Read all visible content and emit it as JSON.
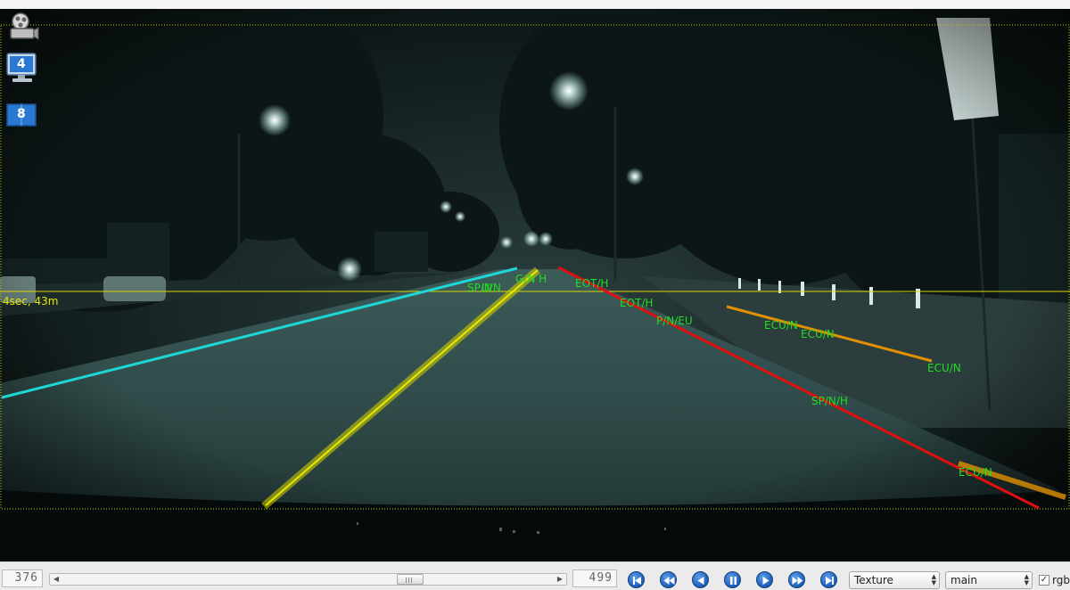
{
  "overlay": {
    "distance_label": "4sec, 43m",
    "lane_labels": [
      "EOT/H",
      "EOT/H",
      "P/N/EU",
      "ECU/N",
      "ECU/N",
      "ECU/N",
      "SP/N/H",
      "ECU/N"
    ],
    "near_vanishing_labels": [
      "SP/N",
      "U/N",
      "G/N H"
    ]
  },
  "desktop_icons": {
    "monitor_4_badge": "4",
    "window_8_badge": "8"
  },
  "player": {
    "current_frame": "376",
    "total_frames": "499",
    "seek_position": 0.72,
    "renderer_select": "Texture",
    "stream_select": "main",
    "rgb_checked": "✓",
    "rgb_label": "rgb",
    "buttons": [
      "first-frame",
      "rewind",
      "step-back",
      "pause",
      "play",
      "fast-forward",
      "last-frame"
    ]
  },
  "colors": {
    "lane_cyan": "#1fd6d6",
    "lane_yellow": "#d6d600",
    "lane_red": "#e01010",
    "lane_orange": "#e09000",
    "label_green": "#22dd22",
    "horizon_line": "#d8d800",
    "control_blue": "#1c5db8"
  }
}
